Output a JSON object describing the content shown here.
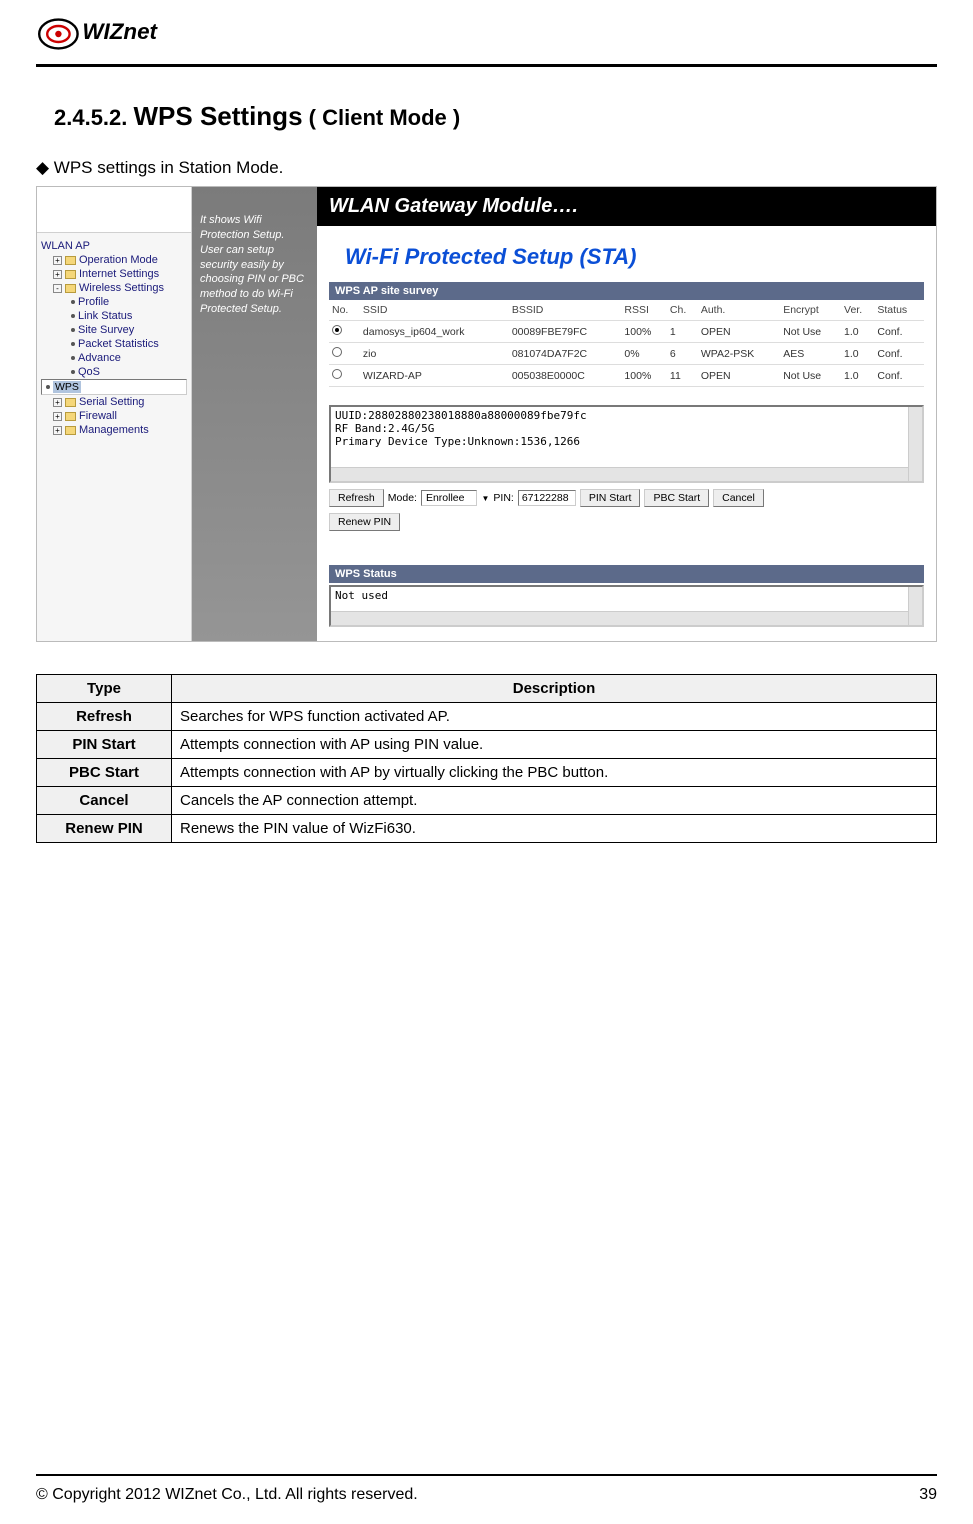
{
  "logo_text": "WIZnet",
  "section_number": "2.4.5.2.",
  "section_title_big": "WPS Settings",
  "section_title_tail": "( Client Mode )",
  "bullet": "◆ WPS settings in Station Mode.",
  "banner": "WLAN Gateway Module….",
  "wps_heading": "Wi-Fi Protected Setup (STA)",
  "survey_header": "WPS AP site survey",
  "tree": {
    "root": "WLAN AP",
    "items": [
      "Operation Mode",
      "Internet Settings",
      "Wireless Settings",
      "Profile",
      "Link Status",
      "Site Survey",
      "Packet Statistics",
      "Advance",
      "QoS",
      "WPS",
      "Serial Setting",
      "Firewall",
      "Managements"
    ]
  },
  "hint": "It shows Wifi Protection Setup. User can setup security easily by choosing PIN or PBC method to do Wi-Fi Protected Setup.",
  "survey": {
    "cols": [
      "No.",
      "SSID",
      "BSSID",
      "RSSI",
      "Ch.",
      "Auth.",
      "Encrypt",
      "Ver.",
      "Status"
    ],
    "rows": [
      {
        "sel": true,
        "ssid": "damosys_ip604_work",
        "bssid": "00089FBE79FC",
        "rssi": "100%",
        "ch": "1",
        "auth": "OPEN",
        "enc": "Not Use",
        "ver": "1.0",
        "st": "Conf."
      },
      {
        "sel": false,
        "ssid": "zio",
        "bssid": "081074DA7F2C",
        "rssi": "0%",
        "ch": "6",
        "auth": "WPA2-PSK",
        "enc": "AES",
        "ver": "1.0",
        "st": "Conf."
      },
      {
        "sel": false,
        "ssid": "WIZARD-AP",
        "bssid": "005038E0000C",
        "rssi": "100%",
        "ch": "11",
        "auth": "OPEN",
        "enc": "Not Use",
        "ver": "1.0",
        "st": "Conf."
      }
    ]
  },
  "textarea": {
    "l1": "UUID:28802880238018880a88000089fbe79fc",
    "l2": "RF Band:2.4G/5G",
    "l3": "Primary Device Type:Unknown:1536,1266"
  },
  "controls": {
    "refresh": "Refresh",
    "mode_lbl": "Mode:",
    "mode_val": "Enrollee",
    "pin_lbl": "PIN:",
    "pin_val": "67122288",
    "pin_start": "PIN Start",
    "pbc_start": "PBC Start",
    "cancel": "Cancel",
    "renew": "Renew PIN"
  },
  "status_header": "WPS Status",
  "status_text": "Not used",
  "desc_table": {
    "head": [
      "Type",
      "Description"
    ],
    "rows": [
      [
        "Refresh",
        "Searches for WPS function activated AP."
      ],
      [
        "PIN Start",
        "Attempts connection with AP using PIN value."
      ],
      [
        "PBC Start",
        "Attempts connection with AP by virtually clicking the PBC button."
      ],
      [
        "Cancel",
        "Cancels the AP connection attempt."
      ],
      [
        "Renew PIN",
        "Renews the PIN value of WizFi630."
      ]
    ]
  },
  "footer": {
    "copy": "© Copyright 2012 WIZnet Co., Ltd. All rights reserved.",
    "page": "39"
  }
}
